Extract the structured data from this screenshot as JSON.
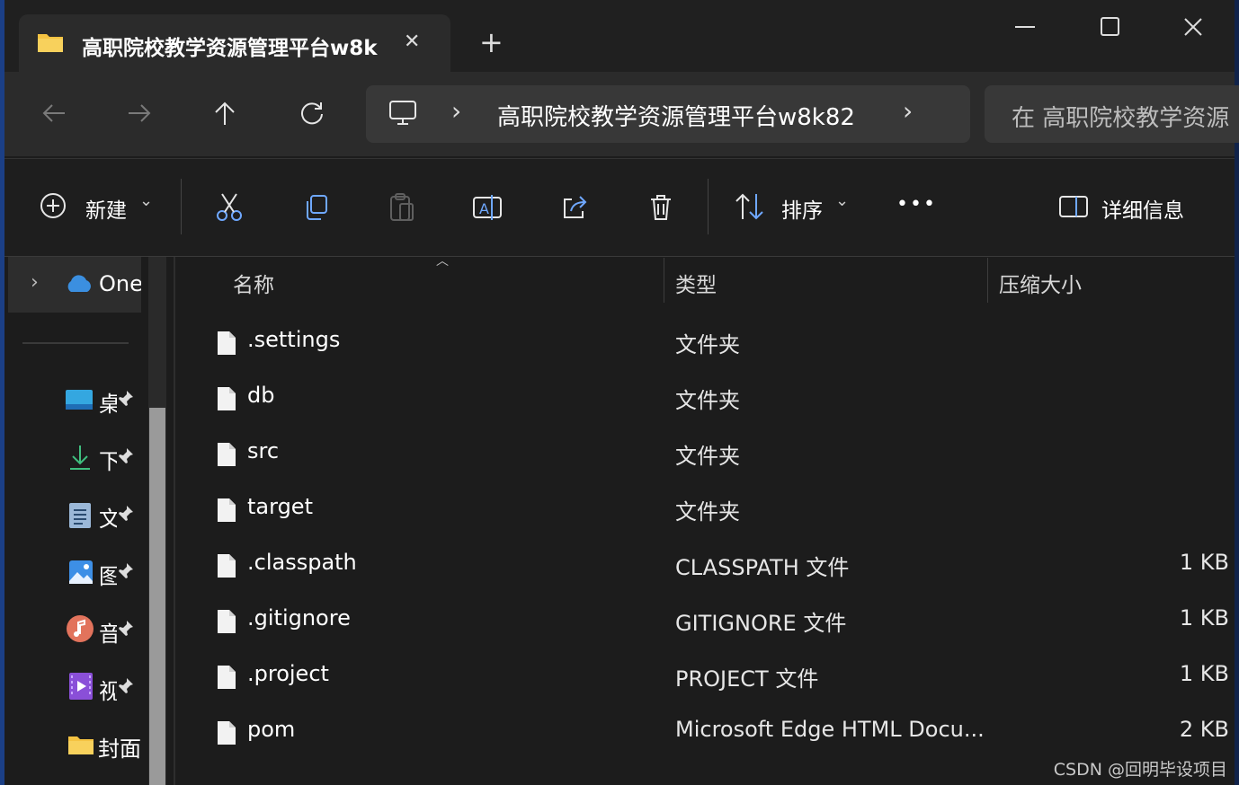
{
  "tab": {
    "title": "高职院校教学资源管理平台w8k",
    "close": "✕",
    "new_tab": "+"
  },
  "window_controls": {
    "minimize": "—",
    "maximize": "☐",
    "close": "✕"
  },
  "nav": {
    "back_icon": "arrow-left",
    "forward_icon": "arrow-right",
    "up_icon": "arrow-up",
    "refresh_icon": "refresh",
    "breadcrumb": {
      "computer_icon": "monitor",
      "separator": "›",
      "folder": "高职院校教学资源管理平台w8k82",
      "expand": "›"
    },
    "search_placeholder": "在 高职院校教学资源"
  },
  "toolbar": {
    "new_label": "新建",
    "new_caret": "⌄",
    "sort_label": "排序",
    "sort_caret": "⌄",
    "more": "•••",
    "details_label": "详细信息",
    "icons": [
      "plus-circle",
      "cut",
      "copy",
      "paste",
      "rename",
      "share",
      "delete",
      "sort",
      "more",
      "details-pane"
    ]
  },
  "sidebar": {
    "onedrive_label": "One",
    "items": [
      {
        "label": "桌",
        "icon": "desktop-icon"
      },
      {
        "label": "下",
        "icon": "download-icon"
      },
      {
        "label": "文",
        "icon": "documents-icon"
      },
      {
        "label": "图",
        "icon": "pictures-icon"
      },
      {
        "label": "音",
        "icon": "music-icon"
      },
      {
        "label": "视",
        "icon": "videos-icon"
      }
    ],
    "folder_label": "封面"
  },
  "columns": {
    "name": "名称",
    "type": "类型",
    "size": "压缩大小"
  },
  "files": [
    {
      "name": ".settings",
      "type": "文件夹",
      "size": ""
    },
    {
      "name": "db",
      "type": "文件夹",
      "size": ""
    },
    {
      "name": "src",
      "type": "文件夹",
      "size": ""
    },
    {
      "name": "target",
      "type": "文件夹",
      "size": ""
    },
    {
      "name": ".classpath",
      "type": "CLASSPATH 文件",
      "size": "1 KB"
    },
    {
      "name": ".gitignore",
      "type": "GITIGNORE 文件",
      "size": "1 KB"
    },
    {
      "name": ".project",
      "type": "PROJECT 文件",
      "size": "1 KB"
    },
    {
      "name": "pom",
      "type": "Microsoft Edge HTML Docu...",
      "size": "2 KB"
    }
  ],
  "watermark": "CSDN @回明毕设项目",
  "colors": {
    "accent_folder": "#f5c342",
    "onedrive": "#3b8fe0",
    "bg": "#1c1c1c"
  }
}
